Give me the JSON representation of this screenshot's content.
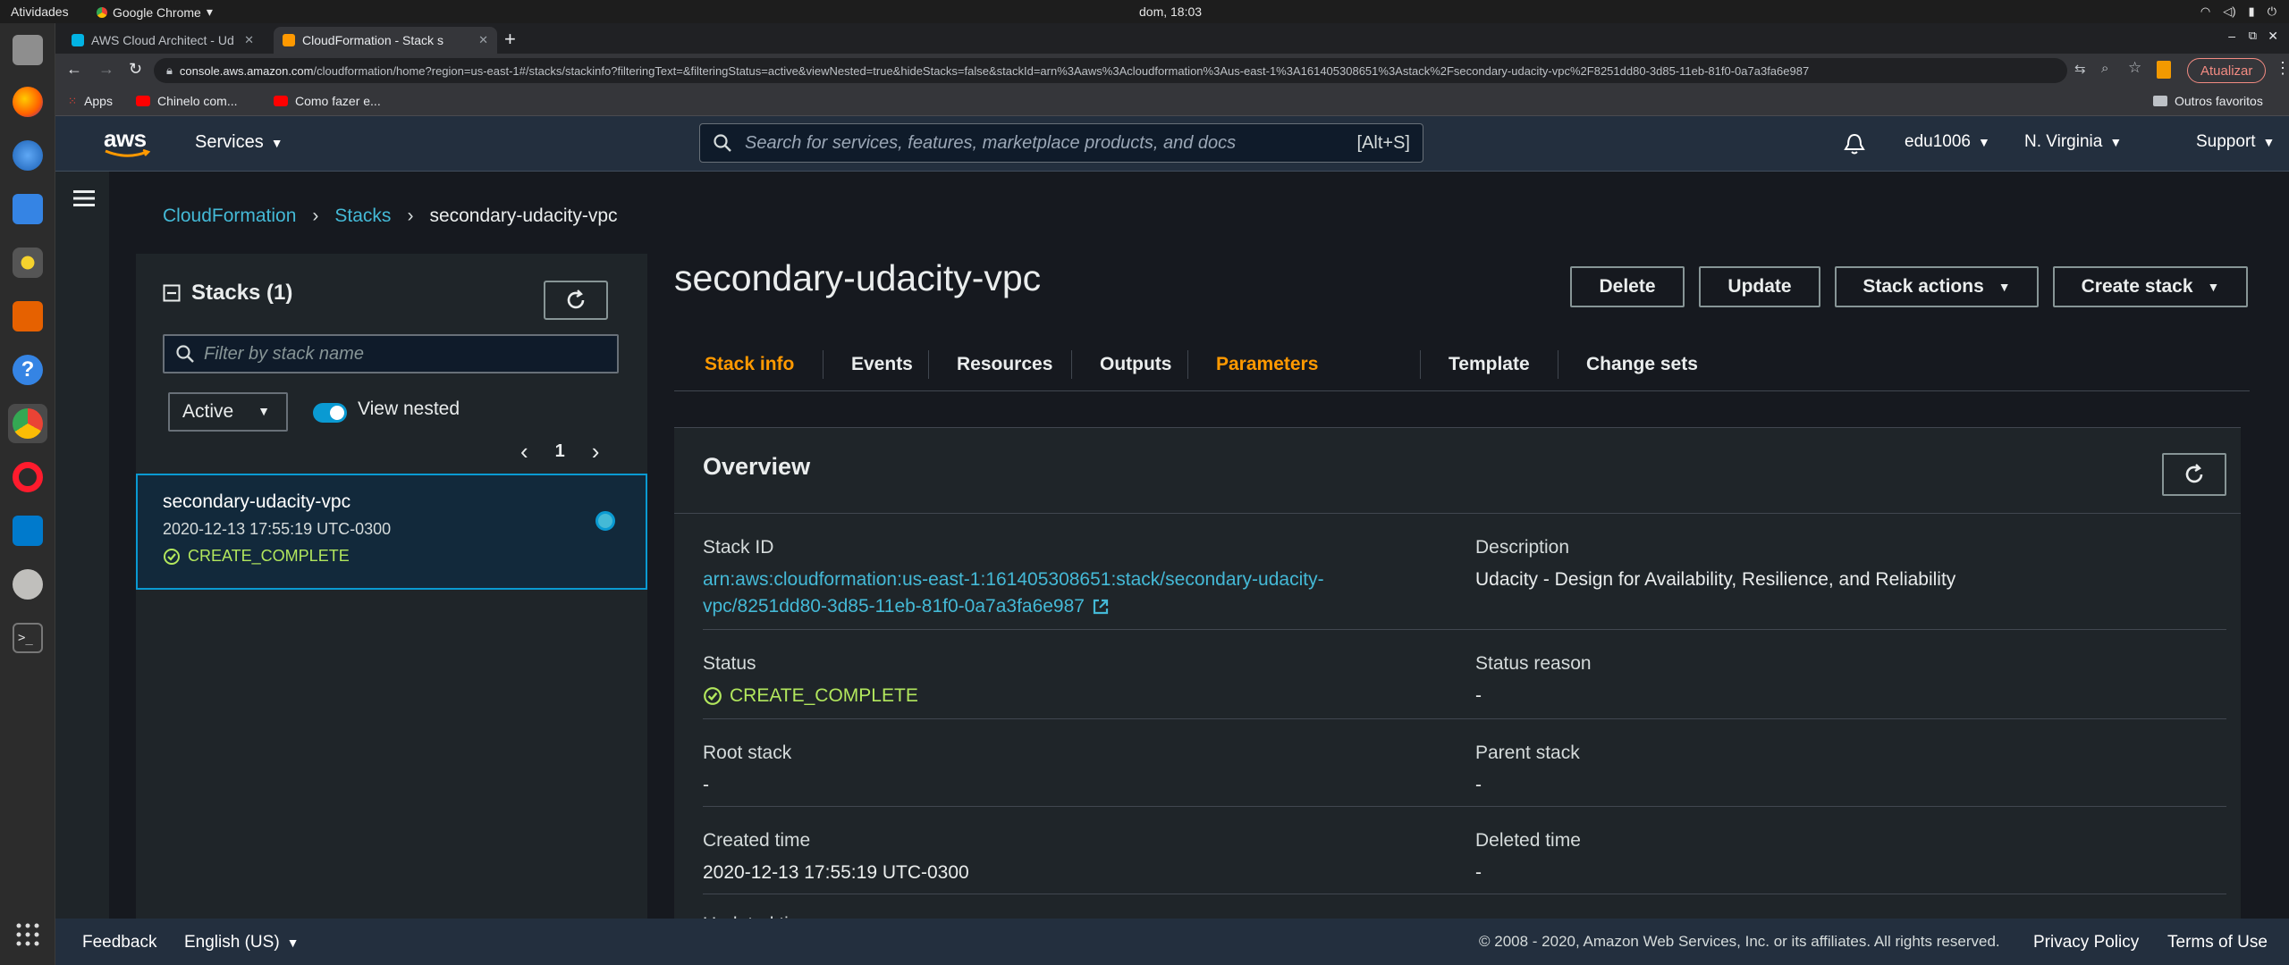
{
  "os": {
    "activities": "Atividades",
    "app_name": "Google Chrome",
    "clock": "dom, 18:03"
  },
  "browser": {
    "tabs": [
      {
        "title": "AWS Cloud Architect - Ud",
        "active": false
      },
      {
        "title": "CloudFormation - Stack s",
        "active": true
      }
    ],
    "url_host": "console.aws.amazon.com",
    "url_path": "/cloudformation/home?region=us-east-1#/stacks/stackinfo?filteringText=&filteringStatus=active&viewNested=true&hideStacks=false&stackId=arn%3Aaws%3Acloudformation%3Aus-east-1%3A161405308651%3Astack%2Fsecondary-udacity-vpc%2F8251dd80-3d85-11eb-81f0-0a7a3fa6e987",
    "update_label": "Atualizar",
    "bookmarks": [
      "Apps",
      "Chinelo com...",
      "Como fazer e..."
    ],
    "other_bookmarks": "Outros favoritos"
  },
  "aws_nav": {
    "logo": "aws",
    "services": "Services",
    "search_placeholder": "Search for services, features, marketplace products, and docs",
    "search_shortcut": "[Alt+S]",
    "account": "edu1006",
    "region": "N. Virginia",
    "support": "Support"
  },
  "breadcrumb": [
    "CloudFormation",
    "Stacks",
    "secondary-udacity-vpc"
  ],
  "stacks_panel": {
    "title": "Stacks (1)",
    "filter_placeholder": "Filter by stack name",
    "status_filter": "Active",
    "view_nested_label": "View nested",
    "page": "1",
    "stack": {
      "name": "secondary-udacity-vpc",
      "created": "2020-12-13 17:55:19 UTC-0300",
      "status": "CREATE_COMPLETE"
    }
  },
  "detail": {
    "stack_name": "secondary-udacity-vpc",
    "buttons": {
      "delete": "Delete",
      "update": "Update",
      "stack_actions": "Stack actions",
      "create_stack": "Create stack"
    },
    "tabs": [
      "Stack info",
      "Events",
      "Resources",
      "Outputs",
      "Parameters",
      "Template",
      "Change sets"
    ],
    "overview": {
      "title": "Overview",
      "stack_id_label": "Stack ID",
      "stack_id_line1": "arn:aws:cloudformation:us-east-1:161405308651:stack/secondary-udacity-",
      "stack_id_line2": "vpc/8251dd80-3d85-11eb-81f0-0a7a3fa6e987",
      "description_label": "Description",
      "description": "Udacity - Design for Availability, Resilience, and Reliability",
      "status_label": "Status",
      "status": "CREATE_COMPLETE",
      "status_reason_label": "Status reason",
      "status_reason": "-",
      "root_stack_label": "Root stack",
      "root_stack": "-",
      "parent_stack_label": "Parent stack",
      "parent_stack": "-",
      "created_time_label": "Created time",
      "created_time": "2020-12-13 17:55:19 UTC-0300",
      "deleted_time_label": "Deleted time",
      "deleted_time": "-",
      "updated_time_label": "Updated time"
    }
  },
  "footer": {
    "feedback": "Feedback",
    "language": "English (US)",
    "copyright": "© 2008 - 2020, Amazon Web Services, Inc. or its affiliates. All rights reserved.",
    "privacy": "Privacy Policy",
    "terms": "Terms of Use"
  },
  "colors": {
    "aws_orange": "#ff9900",
    "link_blue": "#44b9d6",
    "success_green": "#b2e75d",
    "nav_bg": "#232f3e",
    "content_bg": "#16191f"
  }
}
